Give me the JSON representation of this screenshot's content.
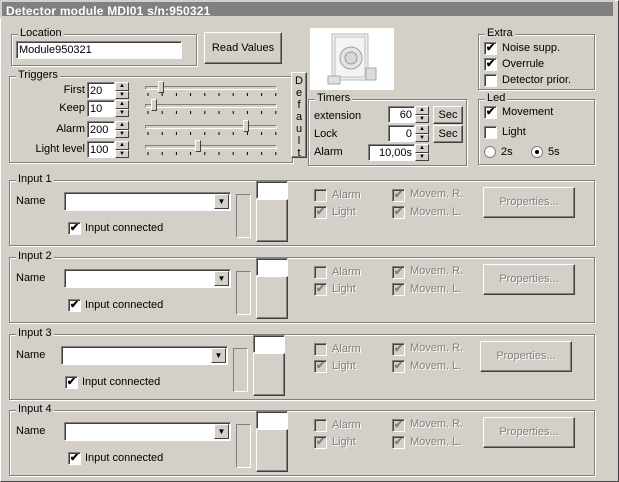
{
  "window": {
    "title": "Detector module MDI01 s/n:950321"
  },
  "location": {
    "group_label": "Location",
    "value": "Module950321",
    "read_values_label": "Read Values"
  },
  "triggers": {
    "group_label": "Triggers",
    "rows": [
      {
        "label": "First",
        "value": "20",
        "level": 0.1
      },
      {
        "label": "Keep",
        "value": "10",
        "level": 0.05
      },
      {
        "label": "Alarm",
        "value": "200",
        "level": 0.78
      },
      {
        "label": "Light level",
        "value": "100",
        "level": 0.4
      }
    ],
    "default_label": [
      "D",
      "e",
      "f",
      "a",
      "u",
      "l",
      "t"
    ]
  },
  "timers": {
    "group_label": "Timers",
    "extension_label": "extension",
    "extension_value": "60",
    "extension_unit": "Sec",
    "lock_label": "Lock",
    "lock_value": "0",
    "lock_unit": "Sec",
    "alarm_label": "Alarm",
    "alarm_value": "10,00s"
  },
  "extra": {
    "group_label": "Extra",
    "items": [
      {
        "label": "Noise supp.",
        "checked": true
      },
      {
        "label": "Overrule",
        "checked": true
      },
      {
        "label": "Detector prior.",
        "checked": false
      }
    ]
  },
  "led": {
    "group_label": "Led",
    "movement_label": "Movement",
    "movement_checked": true,
    "light_label": "Light",
    "light_checked": false,
    "r2s_label": "2s",
    "r5s_label": "5s",
    "selected": "5s"
  },
  "inputs": [
    {
      "label": "Input 1",
      "name_label": "Name",
      "name_value": "",
      "connected_label": "Input connected",
      "alarm_label": "Alarm",
      "light_label": "Light",
      "movr_label": "Movem. R.",
      "movl_label": "Movem. L.",
      "properties_label": "Properties..."
    },
    {
      "label": "Input 2",
      "name_label": "Name",
      "name_value": "",
      "connected_label": "Input connected",
      "alarm_label": "Alarm",
      "light_label": "Light",
      "movr_label": "Movem. R.",
      "movl_label": "Movem. L.",
      "properties_label": "Properties..."
    },
    {
      "label": "Input 3",
      "name_label": "Name",
      "name_value": "",
      "connected_label": "Input connected",
      "alarm_label": "Alarm",
      "light_label": "Light",
      "movr_label": "Movem. R.",
      "movl_label": "Movem. L.",
      "properties_label": "Properties..."
    },
    {
      "label": "Input 4",
      "name_label": "Name",
      "name_value": "",
      "connected_label": "Input connected",
      "alarm_label": "Alarm",
      "light_label": "Light",
      "movr_label": "Movem. R.",
      "movl_label": "Movem. L.",
      "properties_label": "Properties..."
    }
  ],
  "icons": {
    "check": "✔",
    "up": "▲",
    "down": "▼",
    "combo": "▼"
  }
}
